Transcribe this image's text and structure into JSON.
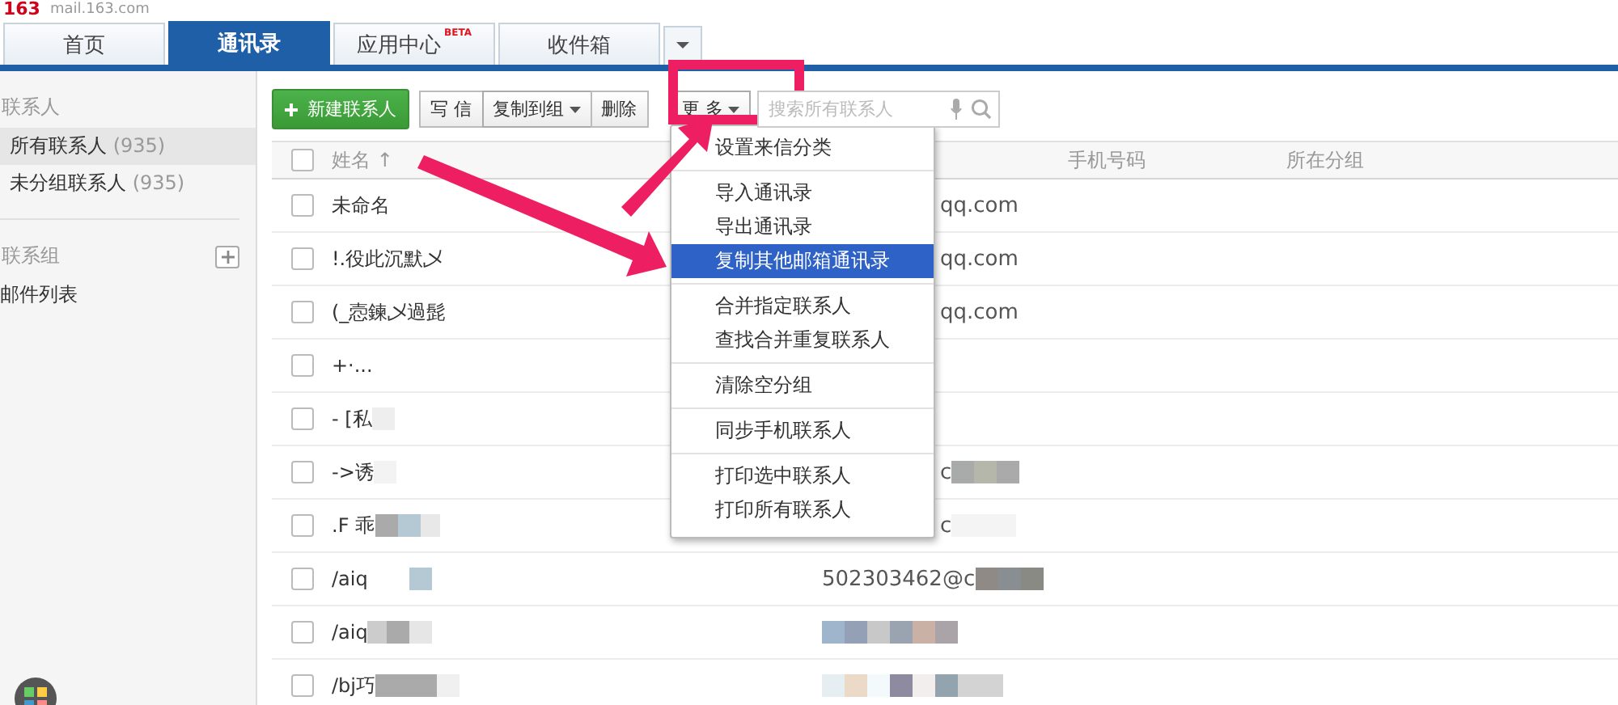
{
  "logo": {
    "mark": "163",
    "domain": "mail.163.com"
  },
  "tabs": [
    {
      "label": "首页",
      "selected": false
    },
    {
      "label": "通讯录",
      "selected": true
    },
    {
      "label": "应用中心",
      "badge": "BETA",
      "selected": false
    },
    {
      "label": "收件箱",
      "selected": false
    }
  ],
  "sidebar": {
    "sections": [
      {
        "title": "联系人",
        "add": false,
        "items": [
          {
            "label": "所有联系人",
            "count": "(935)",
            "selected": true
          },
          {
            "label": "未分组联系人",
            "count": "(935)",
            "selected": false
          }
        ]
      },
      {
        "title": "联系组",
        "add": true,
        "items": [
          {
            "label": "邮件列表",
            "selected": false
          }
        ]
      }
    ]
  },
  "toolbar": {
    "new_button": "新建联系人",
    "buttons": [
      {
        "label": "写 信",
        "dropdown": false
      },
      {
        "label": "复制到组",
        "dropdown": true
      },
      {
        "label": "删除",
        "dropdown": false
      },
      {
        "label": "更 多",
        "dropdown": true
      }
    ],
    "search": {
      "placeholder": "搜索所有联系人"
    }
  },
  "table": {
    "select_all": {
      "checked": false
    },
    "columns": [
      "姓名 ↑",
      "",
      "手机号码",
      "所在分组"
    ],
    "rows": [
      {
        "checked": false,
        "name": "未命名",
        "email": "qq.com"
      },
      {
        "checked": false,
        "name": "!.役此沉默乄",
        "email": "qq.com"
      },
      {
        "checked": false,
        "name": "(_悫鍊乄過髭",
        "email": "qq.com"
      },
      {
        "checked": false,
        "name": "+·...",
        "email": ""
      },
      {
        "checked": false,
        "name": "- [私",
        "email": ""
      },
      {
        "checked": false,
        "name": "->诱",
        "email": "c"
      },
      {
        "checked": false,
        "name": ".F 乖",
        "email": "c"
      },
      {
        "checked": false,
        "name": "/aiq",
        "email": "502303462@c"
      },
      {
        "checked": false,
        "name": "/aiq",
        "email": ""
      },
      {
        "checked": false,
        "name": "/bj巧",
        "email": ""
      }
    ]
  },
  "menu": {
    "groups": [
      [
        {
          "label": "设置来信分类",
          "selected": false
        }
      ],
      [
        {
          "label": "导入通讯录",
          "selected": false
        },
        {
          "label": "导出通讯录",
          "selected": false
        },
        {
          "label": "复制其他邮箱通讯录",
          "selected": true
        }
      ],
      [
        {
          "label": "合并指定联系人",
          "selected": false
        },
        {
          "label": "查找合并重复联系人",
          "selected": false
        }
      ],
      [
        {
          "label": "清除空分组",
          "selected": false
        }
      ],
      [
        {
          "label": "同步手机联系人",
          "selected": false
        }
      ],
      [
        {
          "label": "打印选中联系人",
          "selected": false
        },
        {
          "label": "打印所有联系人",
          "selected": false
        }
      ]
    ]
  }
}
